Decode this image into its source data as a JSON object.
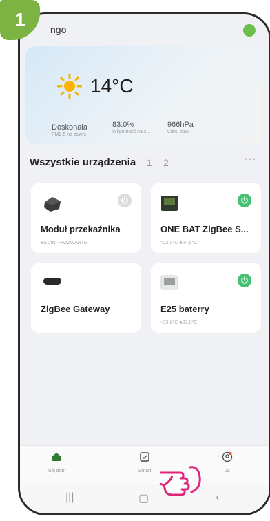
{
  "step_badge": "1",
  "header": {
    "home_name": "ngo"
  },
  "weather": {
    "temperature": "14°C",
    "stats": [
      {
        "value": "Doskonała",
        "label": "PM2.5 na zewn."
      },
      {
        "value": "83.0%",
        "label": "Wilgotność na z..."
      },
      {
        "value": "966hPa",
        "label": "Ciśn. pow."
      }
    ]
  },
  "devices": {
    "heading": "Wszystkie urządzenia",
    "tabs": [
      "1",
      "2"
    ],
    "more": "···",
    "cards": [
      {
        "name": "Moduł przekaźnika",
        "sub": "●S1/IN - ROZWARTE",
        "power": "off"
      },
      {
        "name": "ONE BAT ZigBee S...",
        "sub": "≈22,0°C  ♣24,5°C",
        "power": "on"
      },
      {
        "name": "ZigBee Gateway",
        "sub": "",
        "power": "none"
      },
      {
        "name": "E25 baterry",
        "sub": "≈23,8°C  ♣23,0°C",
        "power": "on"
      }
    ]
  },
  "bottom_nav": [
    {
      "label": "Mój dom",
      "icon": "home-icon"
    },
    {
      "label": "Smart",
      "icon": "smart-check-icon"
    },
    {
      "label": "Ja",
      "icon": "profile-icon"
    }
  ],
  "colors": {
    "accent": "#43c273",
    "badge": "#7cb342",
    "pointer": "#e0267a"
  }
}
